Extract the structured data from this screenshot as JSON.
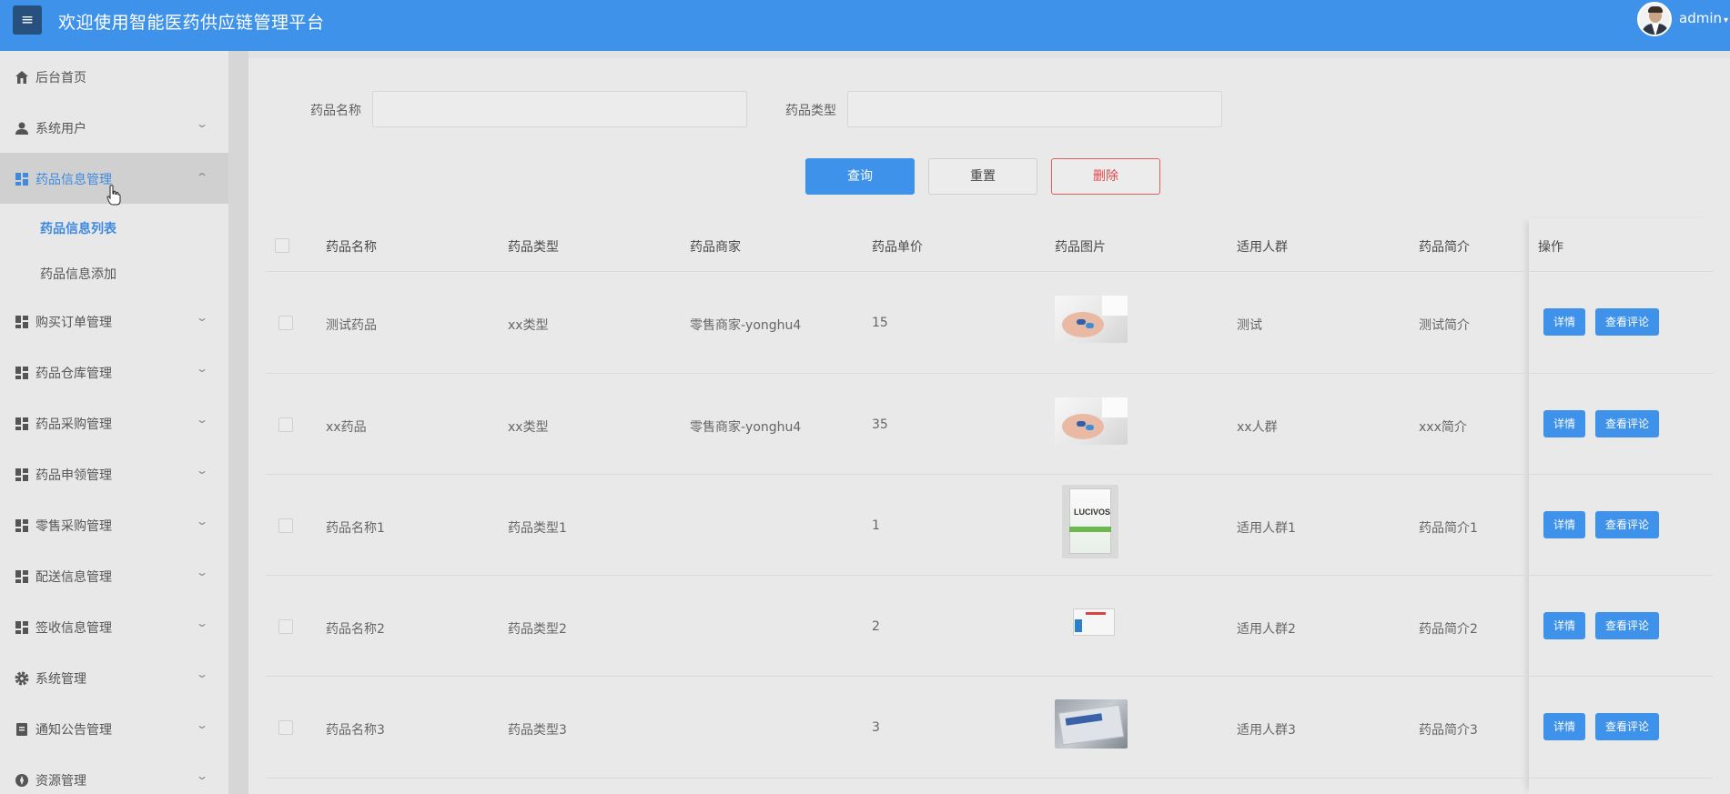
{
  "header": {
    "title": "欢迎使用智能医药供应链管理平台",
    "menu_icon": "≡",
    "user": "admin"
  },
  "sidebar": {
    "items": [
      {
        "label": "后台首页",
        "icon": "home-icon"
      },
      {
        "label": "系统用户",
        "icon": "user-icon"
      },
      {
        "label": "药品信息管理",
        "icon": "grid-icon",
        "expanded": true
      },
      {
        "label": "购买订单管理",
        "icon": "grid-icon"
      },
      {
        "label": "药品仓库管理",
        "icon": "grid-icon"
      },
      {
        "label": "药品采购管理",
        "icon": "grid-icon"
      },
      {
        "label": "药品申领管理",
        "icon": "grid-icon"
      },
      {
        "label": "零售采购管理",
        "icon": "grid-icon"
      },
      {
        "label": "配送信息管理",
        "icon": "grid-icon"
      },
      {
        "label": "签收信息管理",
        "icon": "grid-icon"
      },
      {
        "label": "系统管理",
        "icon": "gear-icon"
      },
      {
        "label": "通知公告管理",
        "icon": "document-icon"
      },
      {
        "label": "资源管理",
        "icon": "compass-icon"
      }
    ],
    "sub_items": [
      {
        "label": "药品信息列表",
        "active": true
      },
      {
        "label": "药品信息添加",
        "active": false
      }
    ]
  },
  "search": {
    "name_label": "药品名称",
    "name_value": "",
    "type_label": "药品类型",
    "type_value": ""
  },
  "buttons": {
    "query": "查询",
    "reset": "重置",
    "delete": "删除"
  },
  "table": {
    "headers": [
      "药品名称",
      "药品类型",
      "药品商家",
      "药品单价",
      "药品图片",
      "适用人群",
      "药品简介",
      "操作"
    ],
    "rows": [
      {
        "name": "测试药品",
        "type": "xx类型",
        "merchant": "零售商家-yonghu4",
        "price": "15",
        "image": "hand-pills",
        "group": "测试",
        "intro": "测试简介"
      },
      {
        "name": "xx药品",
        "type": "xx类型",
        "merchant": "零售商家-yonghu4",
        "price": "35",
        "image": "hand-pills",
        "group": "xx人群",
        "intro": "xxx简介"
      },
      {
        "name": "药品名称1",
        "type": "药品类型1",
        "merchant": "",
        "price": "1",
        "image": "lucivos-box",
        "group": "适用人群1",
        "intro": "药品简介1"
      },
      {
        "name": "药品名称2",
        "type": "药品类型2",
        "merchant": "",
        "price": "2",
        "image": "small-box",
        "group": "适用人群2",
        "intro": "药品简介2"
      },
      {
        "name": "药品名称3",
        "type": "药品类型3",
        "merchant": "",
        "price": "3",
        "image": "blister-pack",
        "group": "适用人群3",
        "intro": "药品简介3"
      }
    ],
    "detail_label": "详情",
    "comment_label": "查看评论",
    "image_brand": "LUCIVOS"
  },
  "colors": {
    "primary": "#3f92ea",
    "danger": "#e24a4a",
    "active_menu": "#3f8ae0"
  }
}
